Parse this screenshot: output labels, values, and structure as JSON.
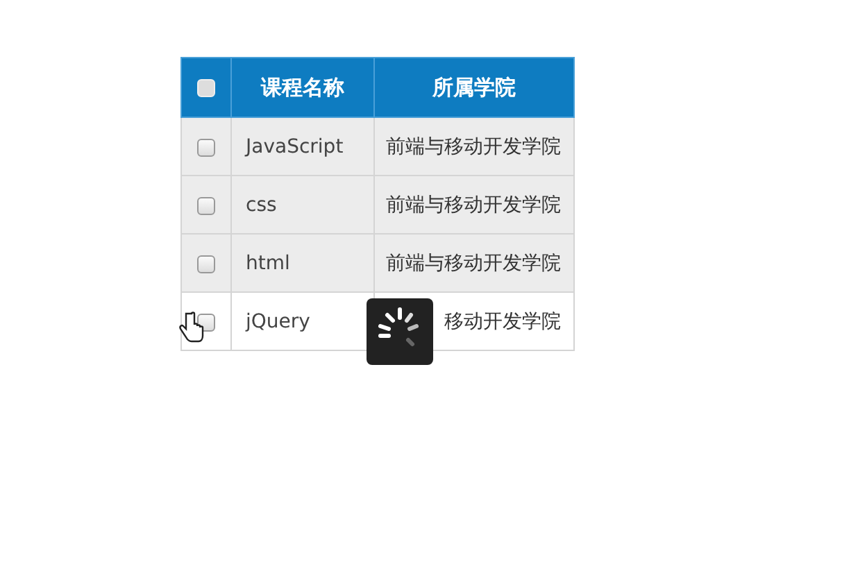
{
  "table": {
    "header_checkbox": {
      "checked": false
    },
    "columns": [
      "课程名称",
      "所属学院"
    ],
    "rows": [
      {
        "checked": false,
        "highlighted": true,
        "cells": [
          "JavaScript",
          "前端与移动开发学院"
        ]
      },
      {
        "checked": false,
        "highlighted": true,
        "cells": [
          "css",
          "前端与移动开发学院"
        ]
      },
      {
        "checked": false,
        "highlighted": true,
        "cells": [
          "html",
          "前端与移动开发学院"
        ]
      },
      {
        "checked": false,
        "highlighted": false,
        "cells": [
          "jQuery",
          "移动开发学院"
        ]
      }
    ]
  },
  "loading": {
    "kind": "spinner"
  }
}
